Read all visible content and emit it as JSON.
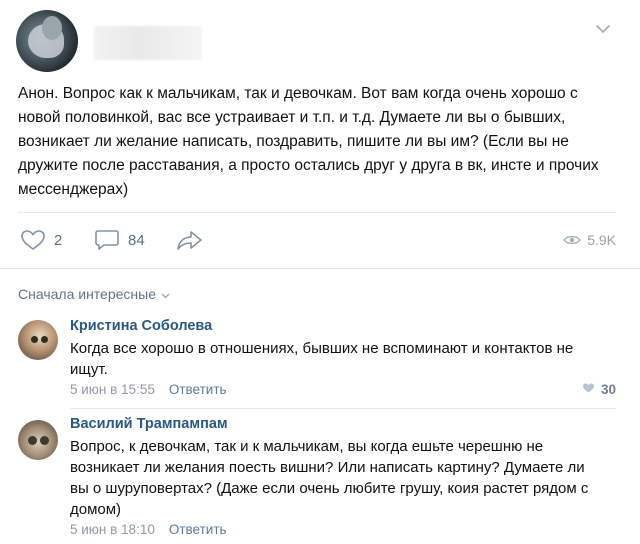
{
  "post": {
    "text": "Анон. Вопрос как к мальчикам, так и девочкам. Вот вам когда очень хорошо с новой половинкой, вас все устраивает и т.п. и т.д. Думаете ли вы о бывших, возникает ли желание написать, поздравить, пишите ли вы им? (Если вы не дружите после расставания, а просто остались друг у друга в вк, инсте и прочих мессенджерах)",
    "actions": {
      "likes": "2",
      "comments": "84",
      "views": "5.9K"
    },
    "icons": {
      "like": "heart-outline-icon",
      "comment": "speech-bubble-icon",
      "share": "share-arrow-icon",
      "views": "eye-icon",
      "menu": "chevron-down-icon"
    }
  },
  "comments_section": {
    "sort_label": "Сначала интересные"
  },
  "comments": [
    {
      "author": "Кристина Соболева",
      "text": "Когда все хорошо в отношениях, бывших не вспоминают и контактов не ищут.",
      "date": "5 июн в 15:55",
      "reply_label": "Ответить",
      "likes": "30"
    },
    {
      "author": "Василий Трампампам",
      "text": "Вопрос, к девочкам, так и к мальчикам, вы когда ешьте черешню не возникает ли желания поесть вишни? Или написать картину? Думаете ли вы о шуруповертах? (Даже если очень любите грушу, коия растет рядом с домом)",
      "date": "5 июн в 18:10",
      "reply_label": "Ответить"
    }
  ],
  "colors": {
    "link": "#2a5885",
    "muted": "#8f9aa7",
    "icon": "#7f8fa4"
  }
}
